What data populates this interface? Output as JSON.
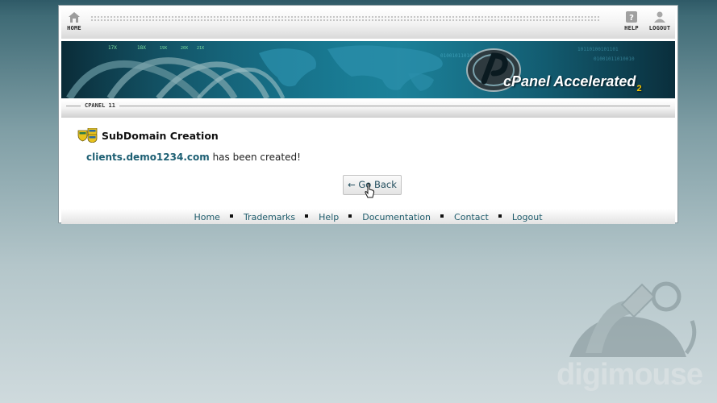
{
  "topbar": {
    "home_label": "HOME",
    "help_label": "HELP",
    "logout_label": "LOGOUT"
  },
  "banner": {
    "brand_main": "cPanel Accelerated",
    "brand_sub": "2"
  },
  "version_label": "CPANEL 11",
  "page": {
    "title": "SubDomain Creation",
    "created_domain": "clients.demo1234.com",
    "message_suffix": " has been created!",
    "go_back_label": "← Go Back"
  },
  "footer": {
    "links": [
      "Home",
      "Trademarks",
      "Help",
      "Documentation",
      "Contact",
      "Logout"
    ]
  },
  "watermark": {
    "brand": "digimouse"
  },
  "colors": {
    "accent_text": "#1d5f73",
    "banner_blue": "#0e5b71",
    "background_top": "#2f5a67",
    "background_bottom": "#cfdadd"
  },
  "icons": [
    "home-icon",
    "help-icon",
    "logout-user-icon",
    "subdomain-icon",
    "mouse-cursor-icon"
  ]
}
